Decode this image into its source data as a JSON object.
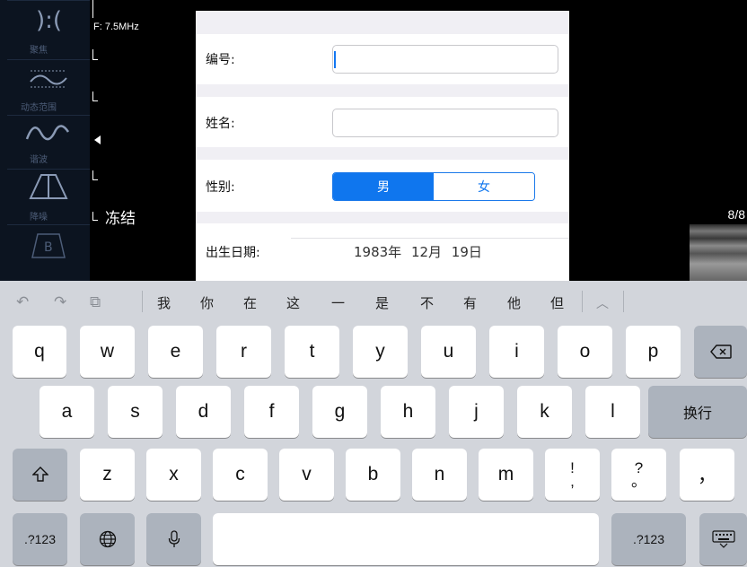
{
  "ultrasound": {
    "frequency": "F: 7.5MHz",
    "freeze_label": "冻结",
    "page_count": "8/8",
    "tools": [
      {
        "label": "聚焦",
        "icon": "focus-icon"
      },
      {
        "label": "动态范围",
        "icon": "dynamic-range-icon"
      },
      {
        "label": "谐波",
        "icon": "harmonic-icon"
      },
      {
        "label": "降噪",
        "icon": "noise-reduction-icon"
      },
      {
        "label": "",
        "icon": "b-mode-icon",
        "glyph": "B"
      }
    ]
  },
  "form": {
    "id_label": "编号:",
    "id_value": "",
    "name_label": "姓名:",
    "name_value": "",
    "gender_label": "性别:",
    "gender_options": [
      "男",
      "女"
    ],
    "gender_selected": "男",
    "dob_label": "出生日期:",
    "dob_value": "1983年 12月 19日"
  },
  "keyboard": {
    "suggestions": [
      "我",
      "你",
      "在",
      "这",
      "一",
      "是",
      "不",
      "有",
      "他",
      "但"
    ],
    "suggest_icons": [
      "undo-icon",
      "redo-icon",
      "paste-icon",
      "chevron-up-icon"
    ],
    "row1": [
      "q",
      "w",
      "e",
      "r",
      "t",
      "y",
      "u",
      "i",
      "o",
      "p"
    ],
    "row2": [
      "a",
      "s",
      "d",
      "f",
      "g",
      "h",
      "j",
      "k",
      "l"
    ],
    "row3": [
      "z",
      "x",
      "c",
      "v",
      "b",
      "n",
      "m"
    ],
    "punct1": {
      "top": "!",
      "bottom": ","
    },
    "punct2": {
      "top": "?",
      "bottom": "。"
    },
    "punct3": "，",
    "return_label": "换行",
    "numbers_label": ".?123",
    "numbers_label_right": ".?123",
    "accent_color": "#0f76ee"
  }
}
